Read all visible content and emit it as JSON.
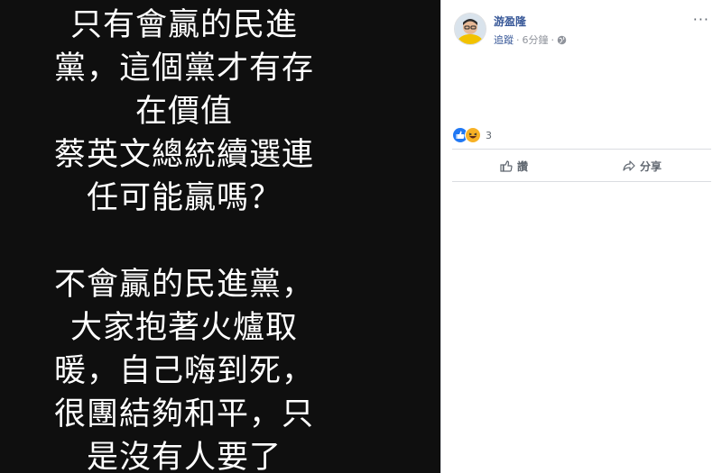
{
  "photo": {
    "lines": [
      "只有會贏的民進",
      "黨，這個黨才有存",
      "在價值",
      "蔡英文總統續選連",
      "任可能贏嗎？",
      "",
      "不會贏的民進黨，",
      "大家抱著火爐取",
      "暖，自己嗨到死，",
      "很團結夠和平，只",
      "是沒有人要了"
    ]
  },
  "post": {
    "author": "游盈隆",
    "follow_label": "追蹤",
    "separator": "·",
    "time": "6分鐘",
    "more_label": "···",
    "privacy_icon": "globe-icon"
  },
  "reactions": {
    "count": "3",
    "icons": [
      "like-reaction-icon",
      "haha-reaction-icon"
    ]
  },
  "actions": {
    "like_label": "讚",
    "share_label": "分享"
  },
  "colors": {
    "photo_bg": "#0f0f0f",
    "link": "#385898",
    "muted": "#90949c",
    "like_blue": "#2078f4"
  }
}
